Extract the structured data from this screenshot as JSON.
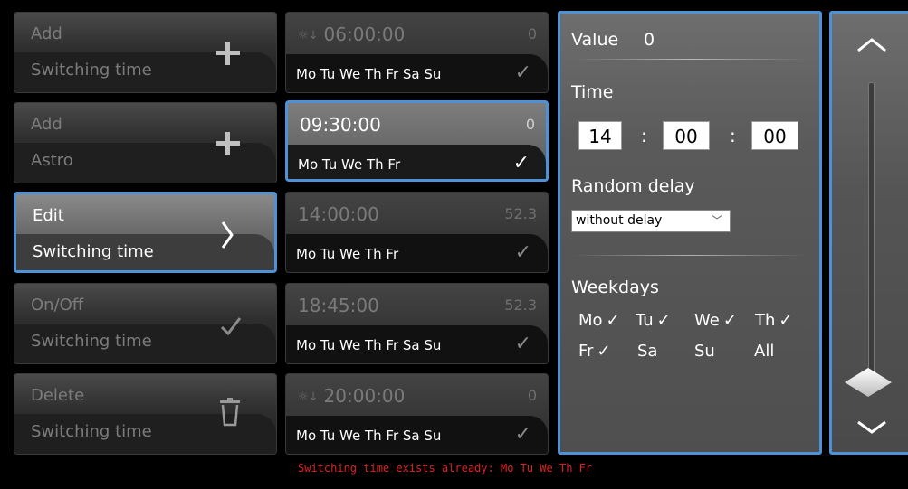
{
  "actions": [
    {
      "title": "Add",
      "subtitle": "Switching time",
      "icon": "plus-icon"
    },
    {
      "title": "Add",
      "subtitle": "Astro",
      "icon": "plus-icon"
    },
    {
      "title": "Edit",
      "subtitle": "Switching time",
      "icon": "chevron-right-icon"
    },
    {
      "title": "On/Off",
      "subtitle": "Switching time",
      "icon": "check-icon"
    },
    {
      "title": "Delete",
      "subtitle": "Switching time",
      "icon": "trash-icon"
    }
  ],
  "slots": [
    {
      "time": "06:00:00",
      "value": "0",
      "days": "Mo Tu We Th Fr Sa Su",
      "astro": true
    },
    {
      "time": "09:30:00",
      "value": "0",
      "days": "Mo Tu We Th Fr",
      "astro": false
    },
    {
      "time": "14:00:00",
      "value": "52.3",
      "days": "Mo Tu We Th Fr",
      "astro": false
    },
    {
      "time": "18:45:00",
      "value": "52.3",
      "days": "Mo Tu We Th Fr Sa Su",
      "astro": false
    },
    {
      "time": "20:00:00",
      "value": "0",
      "days": "Mo Tu We Th Fr Sa Su",
      "astro": true
    }
  ],
  "slot_check": "✓",
  "astro_symbol": "☼↓",
  "error_message": "Switching time exists already: Mo Tu We Th Fr",
  "editor": {
    "value_label": "Value",
    "value": "0",
    "time_label": "Time",
    "hours": "14",
    "minutes": "00",
    "seconds": "00",
    "colon": ":",
    "random_delay_label": "Random delay",
    "random_delay_value": "without delay",
    "weekdays_label": "Weekdays",
    "weekdays": [
      {
        "label": "Mo",
        "checked": true
      },
      {
        "label": "Tu",
        "checked": true
      },
      {
        "label": "We",
        "checked": true
      },
      {
        "label": "Th",
        "checked": true
      },
      {
        "label": "Fr",
        "checked": true
      },
      {
        "label": "Sa",
        "checked": false
      },
      {
        "label": "Su",
        "checked": false
      },
      {
        "label": "All",
        "checked": false
      }
    ],
    "check_glyph": "✓"
  },
  "scroll": {
    "up_icon": "chevron-up-icon",
    "down_icon": "chevron-down-icon"
  },
  "colors": {
    "accent": "#4d92d6",
    "error": "#e02020"
  }
}
